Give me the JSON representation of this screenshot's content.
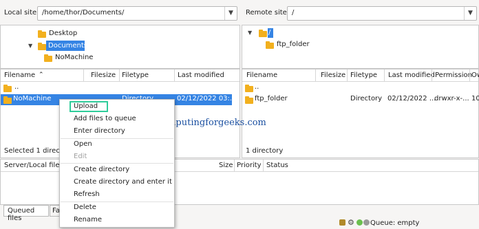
{
  "local": {
    "site_label": "Local site:",
    "path": "/home/thor/Documents/",
    "tree": [
      {
        "label": "Desktop"
      },
      {
        "label": "Documents"
      },
      {
        "label": "NoMachine"
      }
    ],
    "headers": [
      "Filename",
      "Filesize",
      "Filetype",
      "Last modified"
    ],
    "rows": [
      {
        "name": "..",
        "size": "",
        "type": "",
        "modified": ""
      },
      {
        "name": "NoMachine",
        "size": "",
        "type": "Directory",
        "modified": "02/12/2022 03:..."
      }
    ],
    "status": "Selected 1 directory"
  },
  "remote": {
    "site_label": "Remote site:",
    "path": "/",
    "tree": [
      {
        "label": "/"
      },
      {
        "label": "ftp_folder"
      }
    ],
    "headers": [
      "Filename",
      "Filesize",
      "Filetype",
      "Last modified",
      "Permission",
      "Ow"
    ],
    "rows": [
      {
        "name": "..",
        "size": "",
        "type": "",
        "modified": "",
        "perm": "",
        "owner": ""
      },
      {
        "name": "ftp_folder",
        "size": "",
        "type": "Directory",
        "modified": "02/12/2022 ...",
        "perm": "drwxr-x-...",
        "owner": "10("
      }
    ],
    "status": "1 directory"
  },
  "queue": {
    "headers": [
      "Server/Local file",
      "Size",
      "Priority",
      "Status"
    ],
    "tabs": [
      "Queued files",
      "Fa"
    ],
    "status": "Queue: empty"
  },
  "context_menu": {
    "items": [
      {
        "label": "Upload",
        "enabled": true
      },
      {
        "label": "Add files to queue",
        "enabled": true
      },
      {
        "label": "Enter directory",
        "enabled": true
      },
      {
        "label": "Open",
        "enabled": true
      },
      {
        "label": "Edit",
        "enabled": false
      },
      {
        "label": "Create directory",
        "enabled": true
      },
      {
        "label": "Create directory and enter it",
        "enabled": true
      },
      {
        "label": "Refresh",
        "enabled": true
      },
      {
        "label": "Delete",
        "enabled": true
      },
      {
        "label": "Rename",
        "enabled": true
      }
    ]
  },
  "watermark": "computingforgeeks.com",
  "colors": {
    "selection": "#3584e4",
    "folder": "#f2b01e",
    "highlight_box": "#2ecc9a",
    "watermark": "#1a4fa0"
  }
}
